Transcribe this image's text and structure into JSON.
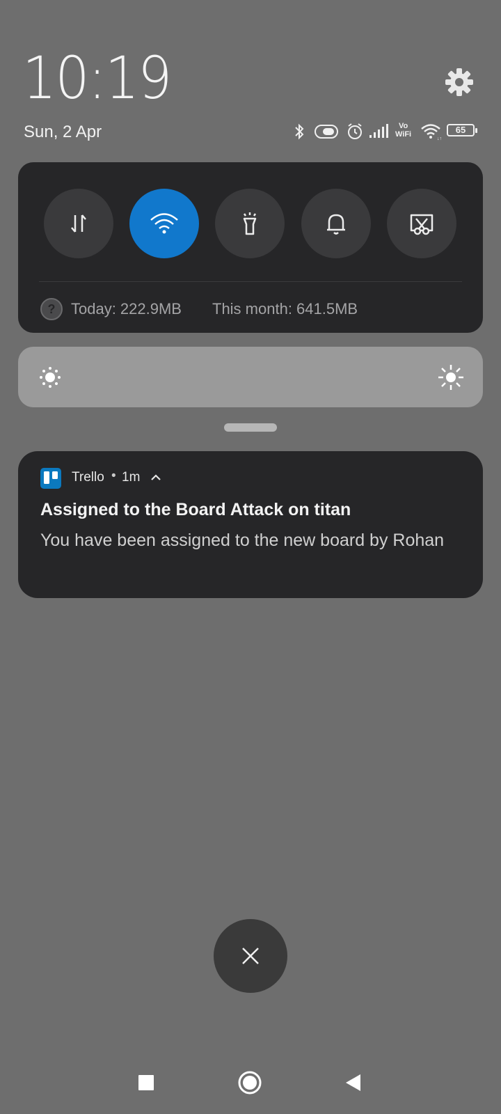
{
  "status": {
    "time": "10:19",
    "date": "Sun, 2 Apr",
    "battery": "65",
    "icons": [
      "bluetooth-icon",
      "toggle-icon",
      "alarm-icon",
      "cellular-signal-icon",
      "vowifi-icon",
      "wifi-icon",
      "battery-icon"
    ],
    "vowifi_top": "Vo",
    "vowifi_bottom": "WiFi"
  },
  "quick_settings": {
    "tiles": [
      {
        "name": "mobile-data",
        "icon": "data-transfer-icon",
        "active": false
      },
      {
        "name": "wifi",
        "icon": "wifi-icon",
        "active": true
      },
      {
        "name": "flashlight",
        "icon": "flashlight-icon",
        "active": false
      },
      {
        "name": "sound",
        "icon": "bell-icon",
        "active": false
      },
      {
        "name": "screenshot",
        "icon": "screenshot-scissors-icon",
        "active": false
      }
    ],
    "usage_today": "Today: 222.9MB",
    "usage_month": "This month: 641.5MB"
  },
  "notification": {
    "app_name": "Trello",
    "separator": "•",
    "time": "1m",
    "title": "Assigned to the Board Attack on titan",
    "body": "You have been assigned to the new board by Rohan"
  },
  "colors": {
    "background": "#6e6e6e",
    "panel": "#262628",
    "accent": "#1178cc",
    "trello": "#0b79bf"
  }
}
